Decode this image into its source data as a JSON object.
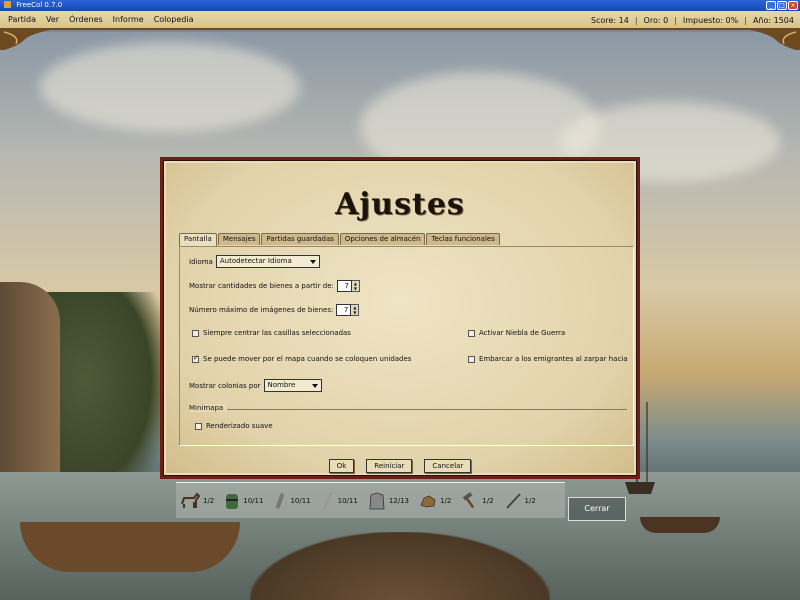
{
  "window": {
    "title": "FreeCol 0.7.0"
  },
  "menubar": {
    "items": [
      "Partida",
      "Ver",
      "Órdenes",
      "Informe",
      "Colopedia"
    ],
    "status": {
      "score": "Score: 14",
      "gold": "Oro: 0",
      "tax": "Impuesto: 0%",
      "year": "Año: 1504"
    }
  },
  "dialog": {
    "title": "Ajustes",
    "tabs": [
      "Pantalla",
      "Mensajes",
      "Partidas guardadas",
      "Opciones de almacén",
      "Teclas funcionales"
    ],
    "active_tab": "Pantalla",
    "fields": {
      "language_label": "Idioma",
      "language_value": "Autodetectar Idioma",
      "goods_amount_label": "Mostrar cantidades de bienes a partir de:",
      "goods_amount_value": "7",
      "max_images_label": "Número máximo de imágenes de bienes:",
      "max_images_value": "7",
      "always_center_label": "Siempre centrar las casillas seleccionadas",
      "always_center_checked": false,
      "fog_of_war_label": "Activar Niebla de Guerra",
      "fog_of_war_checked": false,
      "move_map_label": "Se puede mover por el mapa cuando se coloquen unidades",
      "move_map_checked": true,
      "embark_label": "Embarcar a los emigrantes al zarpar hacia",
      "embark_checked": false,
      "colonies_label": "Mostrar colonias por",
      "colonies_value": "Nombre",
      "minimap_legend": "Minimapa",
      "smooth_render_label": "Renderizado suave",
      "smooth_render_checked": false
    },
    "buttons": {
      "ok": "Ok",
      "reset": "Reiniciar",
      "cancel": "Cancelar"
    }
  },
  "goods": [
    {
      "icon": "horse-icon",
      "count": "1/2"
    },
    {
      "icon": "barrel-icon",
      "count": "10/11"
    },
    {
      "icon": "tool-icon",
      "count": "10/11"
    },
    {
      "icon": "musket-icon",
      "count": "10/11"
    },
    {
      "icon": "cloth-icon",
      "count": "12/13"
    },
    {
      "icon": "ore-icon",
      "count": "1/2"
    },
    {
      "icon": "hammer-icon",
      "count": "1/2"
    },
    {
      "icon": "sword-icon",
      "count": "1/2"
    }
  ],
  "close_button": "Cerrar"
}
